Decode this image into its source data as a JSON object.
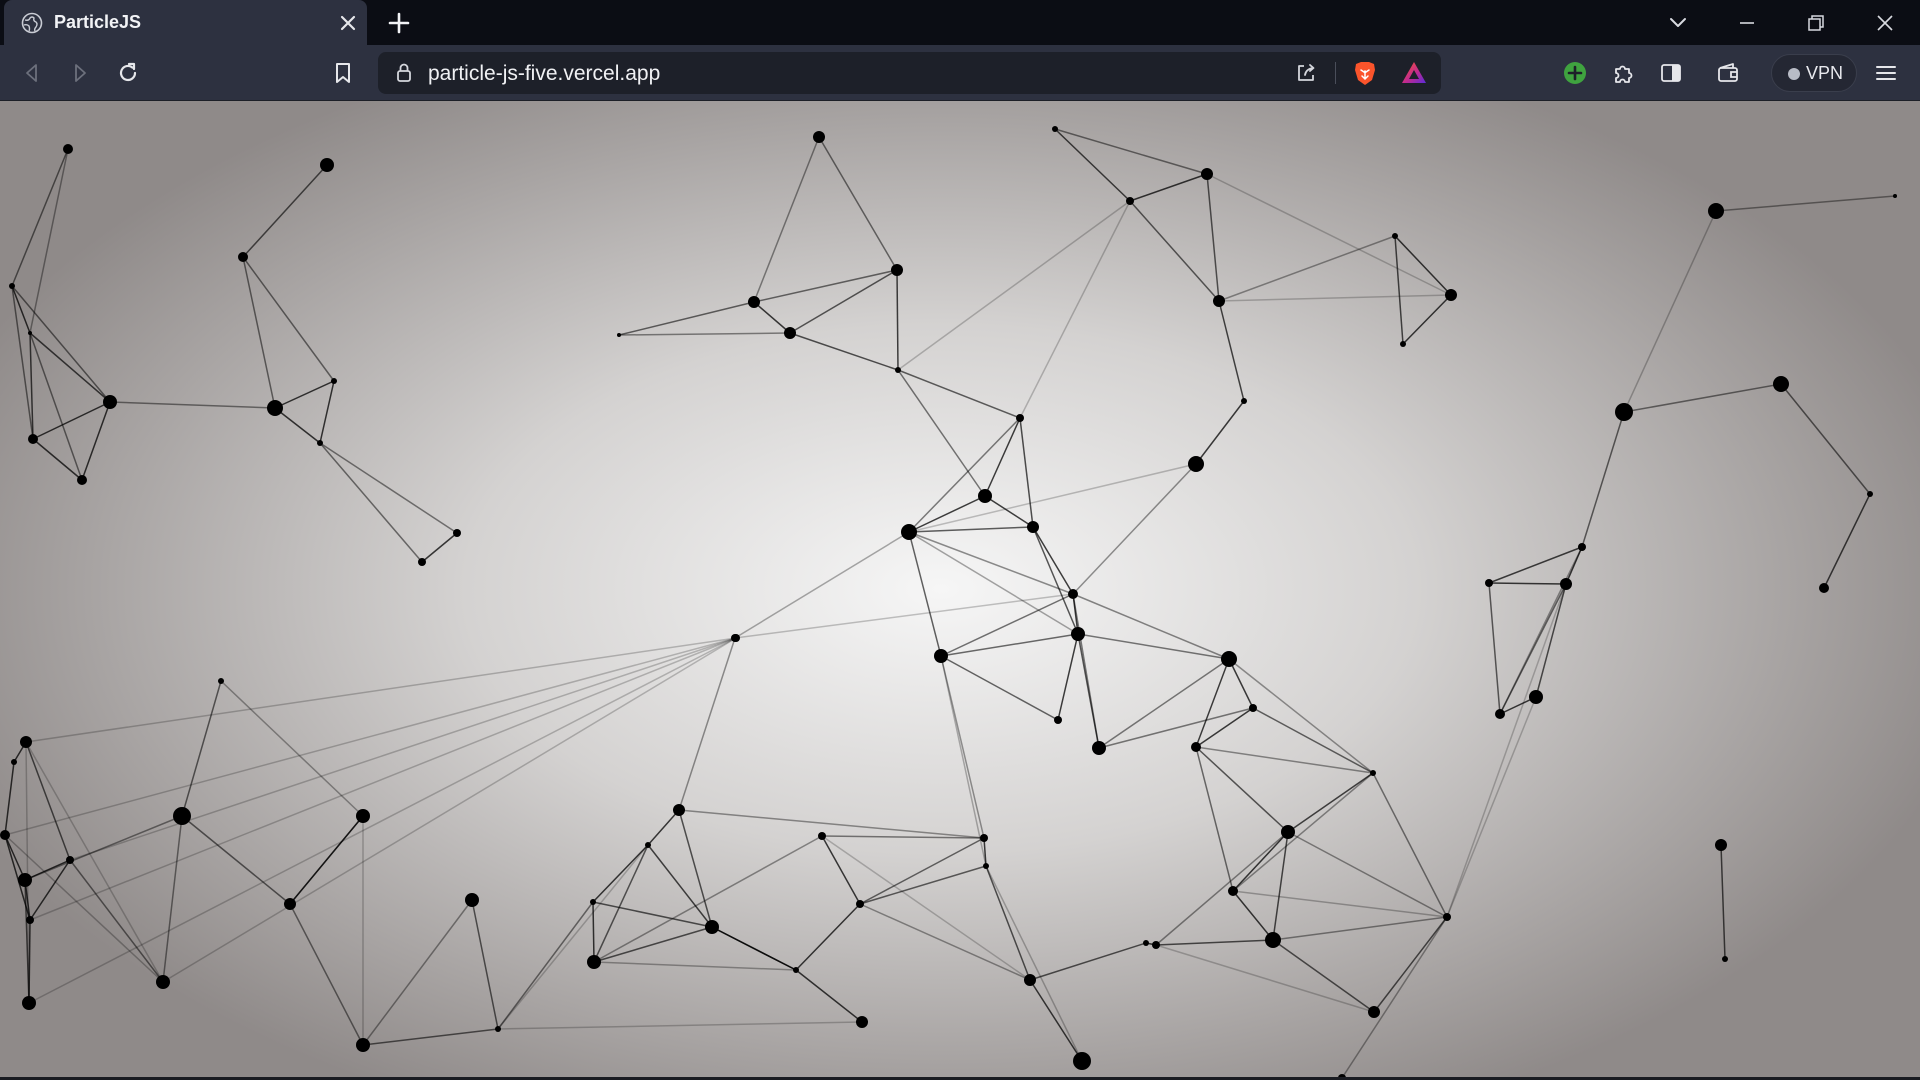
{
  "browser": {
    "tab": {
      "title": "ParticleJS",
      "favicon": "globe-icon"
    },
    "address_bar": {
      "url": "particle-js-five.vercel.app"
    },
    "vpn_label": "VPN",
    "icons": {
      "back": "arrow-left-icon",
      "forward": "arrow-right-icon",
      "reload": "reload-icon",
      "bookmark": "bookmark-icon",
      "lock": "lock-icon",
      "share": "share-icon",
      "shields": "brave-lion-icon",
      "rewards": "brave-rewards-triangle-icon",
      "extension_add": "plus-circle-icon",
      "extensions": "puzzle-icon",
      "sidebar": "sidebar-icon",
      "wallet": "wallet-icon",
      "menu": "hamburger-menu-icon"
    },
    "colors": {
      "tab_active": "#2d3140",
      "tab_bar": "#0b0d14",
      "brave_orange": "#fb542b",
      "extension_green": "#3fa33f",
      "particle": "#000000"
    }
  },
  "particles": {
    "count": 92,
    "link_color": "#000000"
  }
}
